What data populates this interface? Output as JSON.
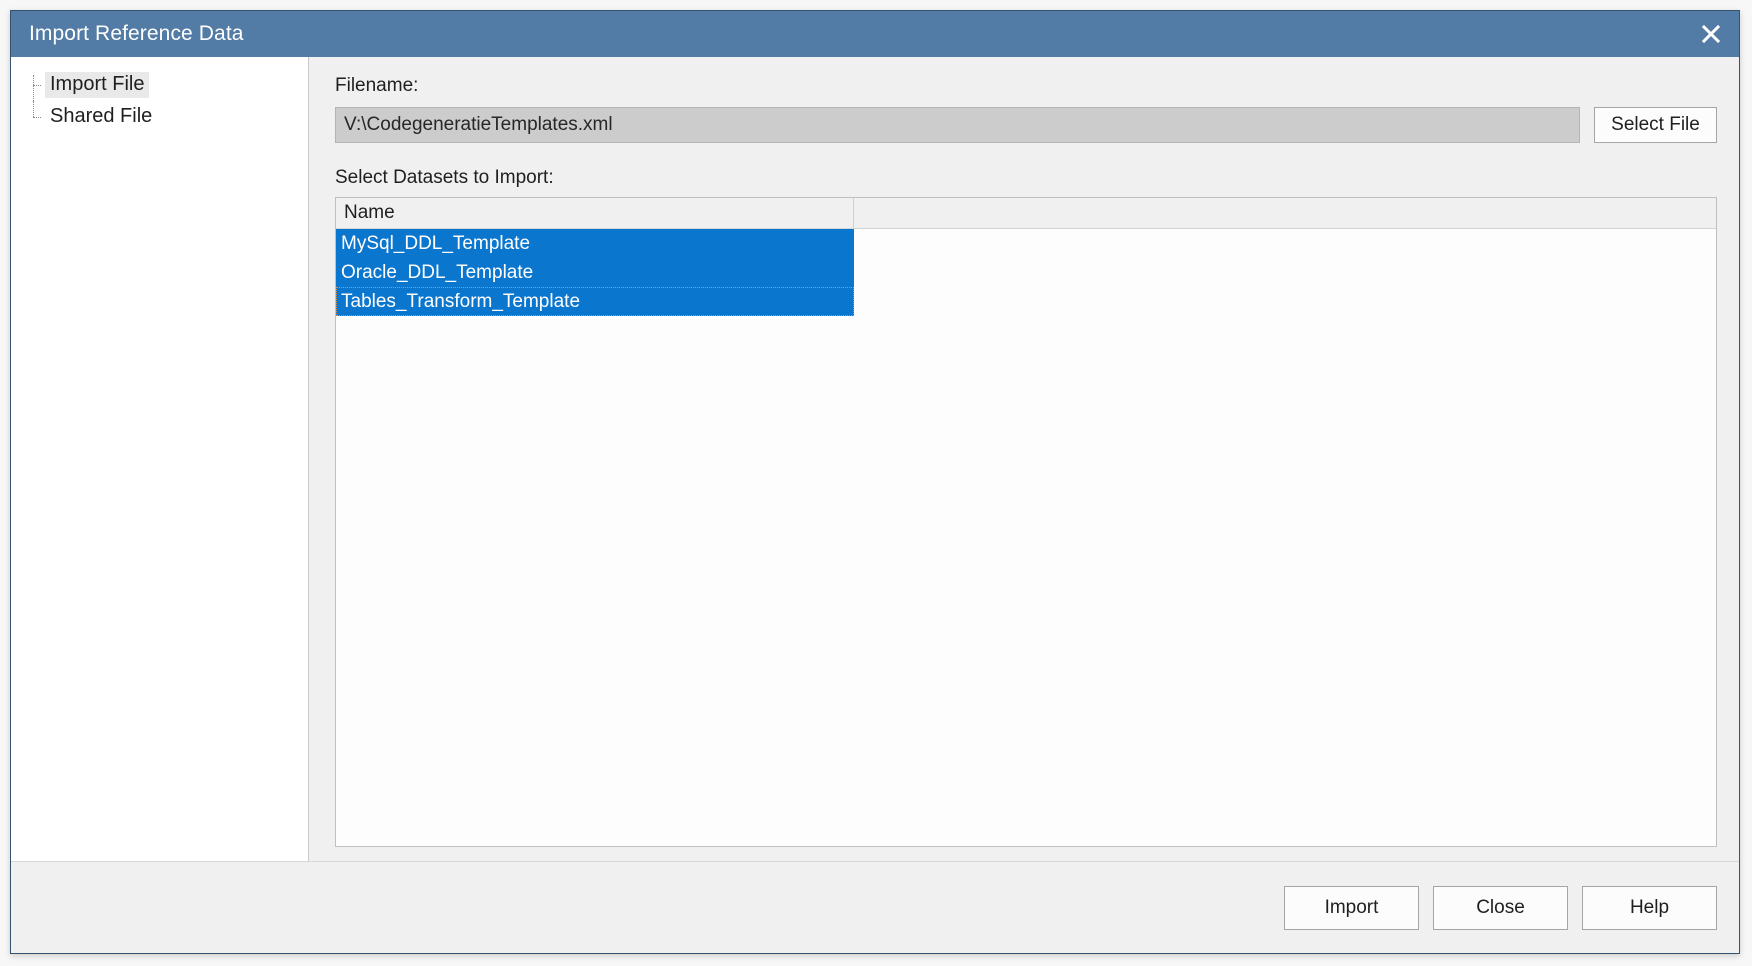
{
  "window": {
    "title": "Import Reference Data",
    "close_icon": "close-x-icon",
    "titlebar_color": "#527ba5",
    "selection_color": "#0b76ce",
    "focus_outline_color": "#e08a3c"
  },
  "sidebar": {
    "items": [
      {
        "label": "Import File",
        "selected": true
      },
      {
        "label": "Shared File",
        "selected": false
      }
    ]
  },
  "main": {
    "filename": {
      "label": "Filename:",
      "value": "V:\\CodegeneratieTemplates.xml",
      "placeholder": "",
      "select_file_label": "Select File"
    },
    "datasets": {
      "label": "Select Datasets to Import:",
      "columns": [
        "Name",
        ""
      ],
      "rows": [
        {
          "name": "MySql_DDL_Template",
          "selected": true,
          "focused": false
        },
        {
          "name": "Oracle_DDL_Template",
          "selected": true,
          "focused": false
        },
        {
          "name": "Tables_Transform_Template",
          "selected": true,
          "focused": true
        }
      ]
    }
  },
  "footer": {
    "import_label": "Import",
    "close_label": "Close",
    "help_label": "Help"
  }
}
